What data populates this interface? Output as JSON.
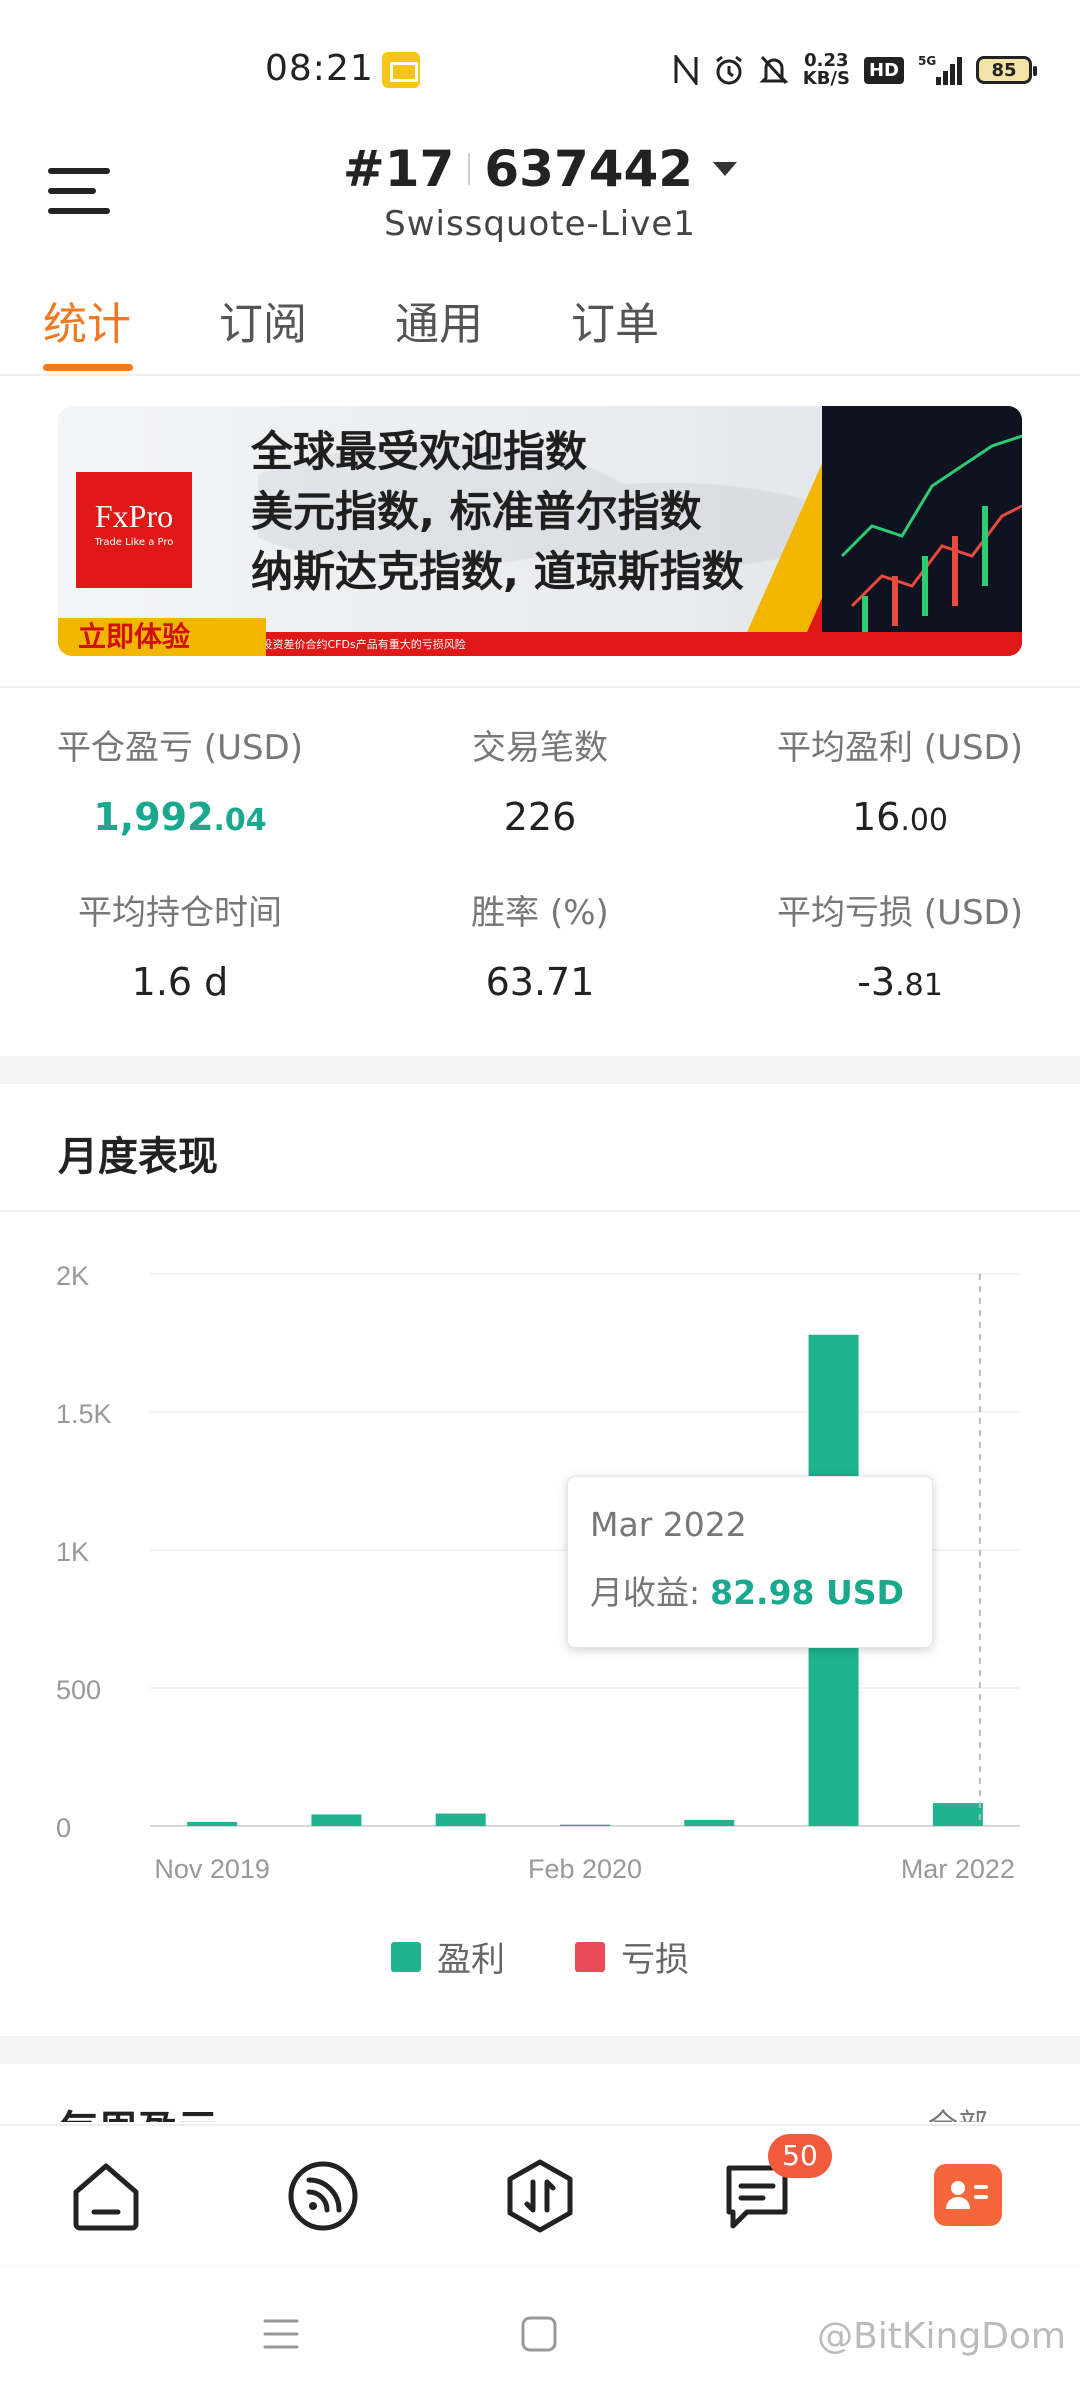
{
  "status_bar": {
    "time": "08:21",
    "speed_value": "0.23",
    "speed_unit": "KB/S",
    "hd": "HD",
    "network": "5G",
    "battery": "85"
  },
  "header": {
    "account_prefix": "#17",
    "account_number": "637442",
    "server": "Swissquote-Live1"
  },
  "tabs": [
    {
      "label": "统计",
      "active": true
    },
    {
      "label": "订阅",
      "active": false
    },
    {
      "label": "通用",
      "active": false
    },
    {
      "label": "订单",
      "active": false
    }
  ],
  "banner": {
    "logo_name": "FxPro",
    "logo_tagline": "Trade Like a Pro",
    "lines": [
      "全球最受欢迎指数",
      "美元指数, 标准普尔指数",
      "纳斯达克指数, 道琼斯指数"
    ],
    "cta": "立即体验",
    "disclaimer": "*投资差价合约CFDs产品有重大的亏损风险"
  },
  "stats": [
    {
      "label": "平仓盈亏 (USD)",
      "int": "1,992",
      "dec": ".04",
      "green": true
    },
    {
      "label": "交易笔数",
      "int": "226",
      "dec": "",
      "green": false
    },
    {
      "label": "平均盈利 (USD)",
      "int": "16",
      "dec": ".00",
      "green": false
    },
    {
      "label": "平均持仓时间",
      "int": "1.6 d",
      "dec": "",
      "green": false
    },
    {
      "label": "胜率 (%)",
      "int": "63.71",
      "dec": "",
      "green": false
    },
    {
      "label": "平均亏损 (USD)",
      "int": "-3",
      "dec": ".81",
      "green": false
    }
  ],
  "monthly": {
    "title": "月度表现"
  },
  "chart_data": {
    "type": "bar",
    "categories": [
      "Nov 2019",
      "",
      "",
      "Feb 2020",
      "",
      "",
      "Mar 2022"
    ],
    "x_tick_labels": [
      "Nov 2019",
      "Feb 2020",
      "Mar 2022"
    ],
    "series": [
      {
        "name": "盈利",
        "color": "#1fb390",
        "values": [
          15,
          42,
          45,
          5,
          22,
          1780,
          82.98
        ]
      },
      {
        "name": "亏损",
        "color": "#e94b58",
        "values": [
          0,
          0,
          0,
          0,
          0,
          0,
          0
        ]
      }
    ],
    "y_ticks": [
      "0",
      "500",
      "1K",
      "1.5K",
      "2K"
    ],
    "ylim": [
      0,
      2000
    ],
    "grid": true,
    "legend_position": "bottom"
  },
  "tooltip": {
    "date": "Mar 2022",
    "label": "月收益:",
    "value": "82.98 USD"
  },
  "next_section": {
    "title": "每周盈亏",
    "link": "全部"
  },
  "bottom_nav": {
    "messages_badge": "50"
  },
  "watermark": "@BitKingDom"
}
